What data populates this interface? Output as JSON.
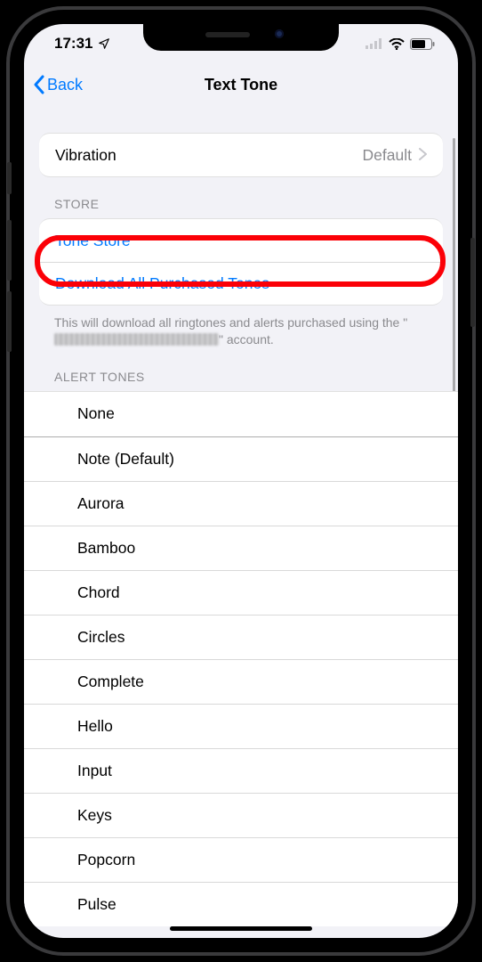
{
  "status": {
    "time": "17:31"
  },
  "nav": {
    "back_label": "Back",
    "title": "Text Tone"
  },
  "vibration": {
    "label": "Vibration",
    "value": "Default"
  },
  "store": {
    "header": "STORE",
    "tone_store": "Tone Store",
    "download_all": "Download All Purchased Tones",
    "footer_pre": "This will download all ringtones and alerts purchased using the \"",
    "footer_post": "\" account."
  },
  "alert_tones": {
    "header": "ALERT TONES",
    "items": [
      "None",
      "Note (Default)",
      "Aurora",
      "Bamboo",
      "Chord",
      "Circles",
      "Complete",
      "Hello",
      "Input",
      "Keys",
      "Popcorn",
      "Pulse"
    ]
  }
}
